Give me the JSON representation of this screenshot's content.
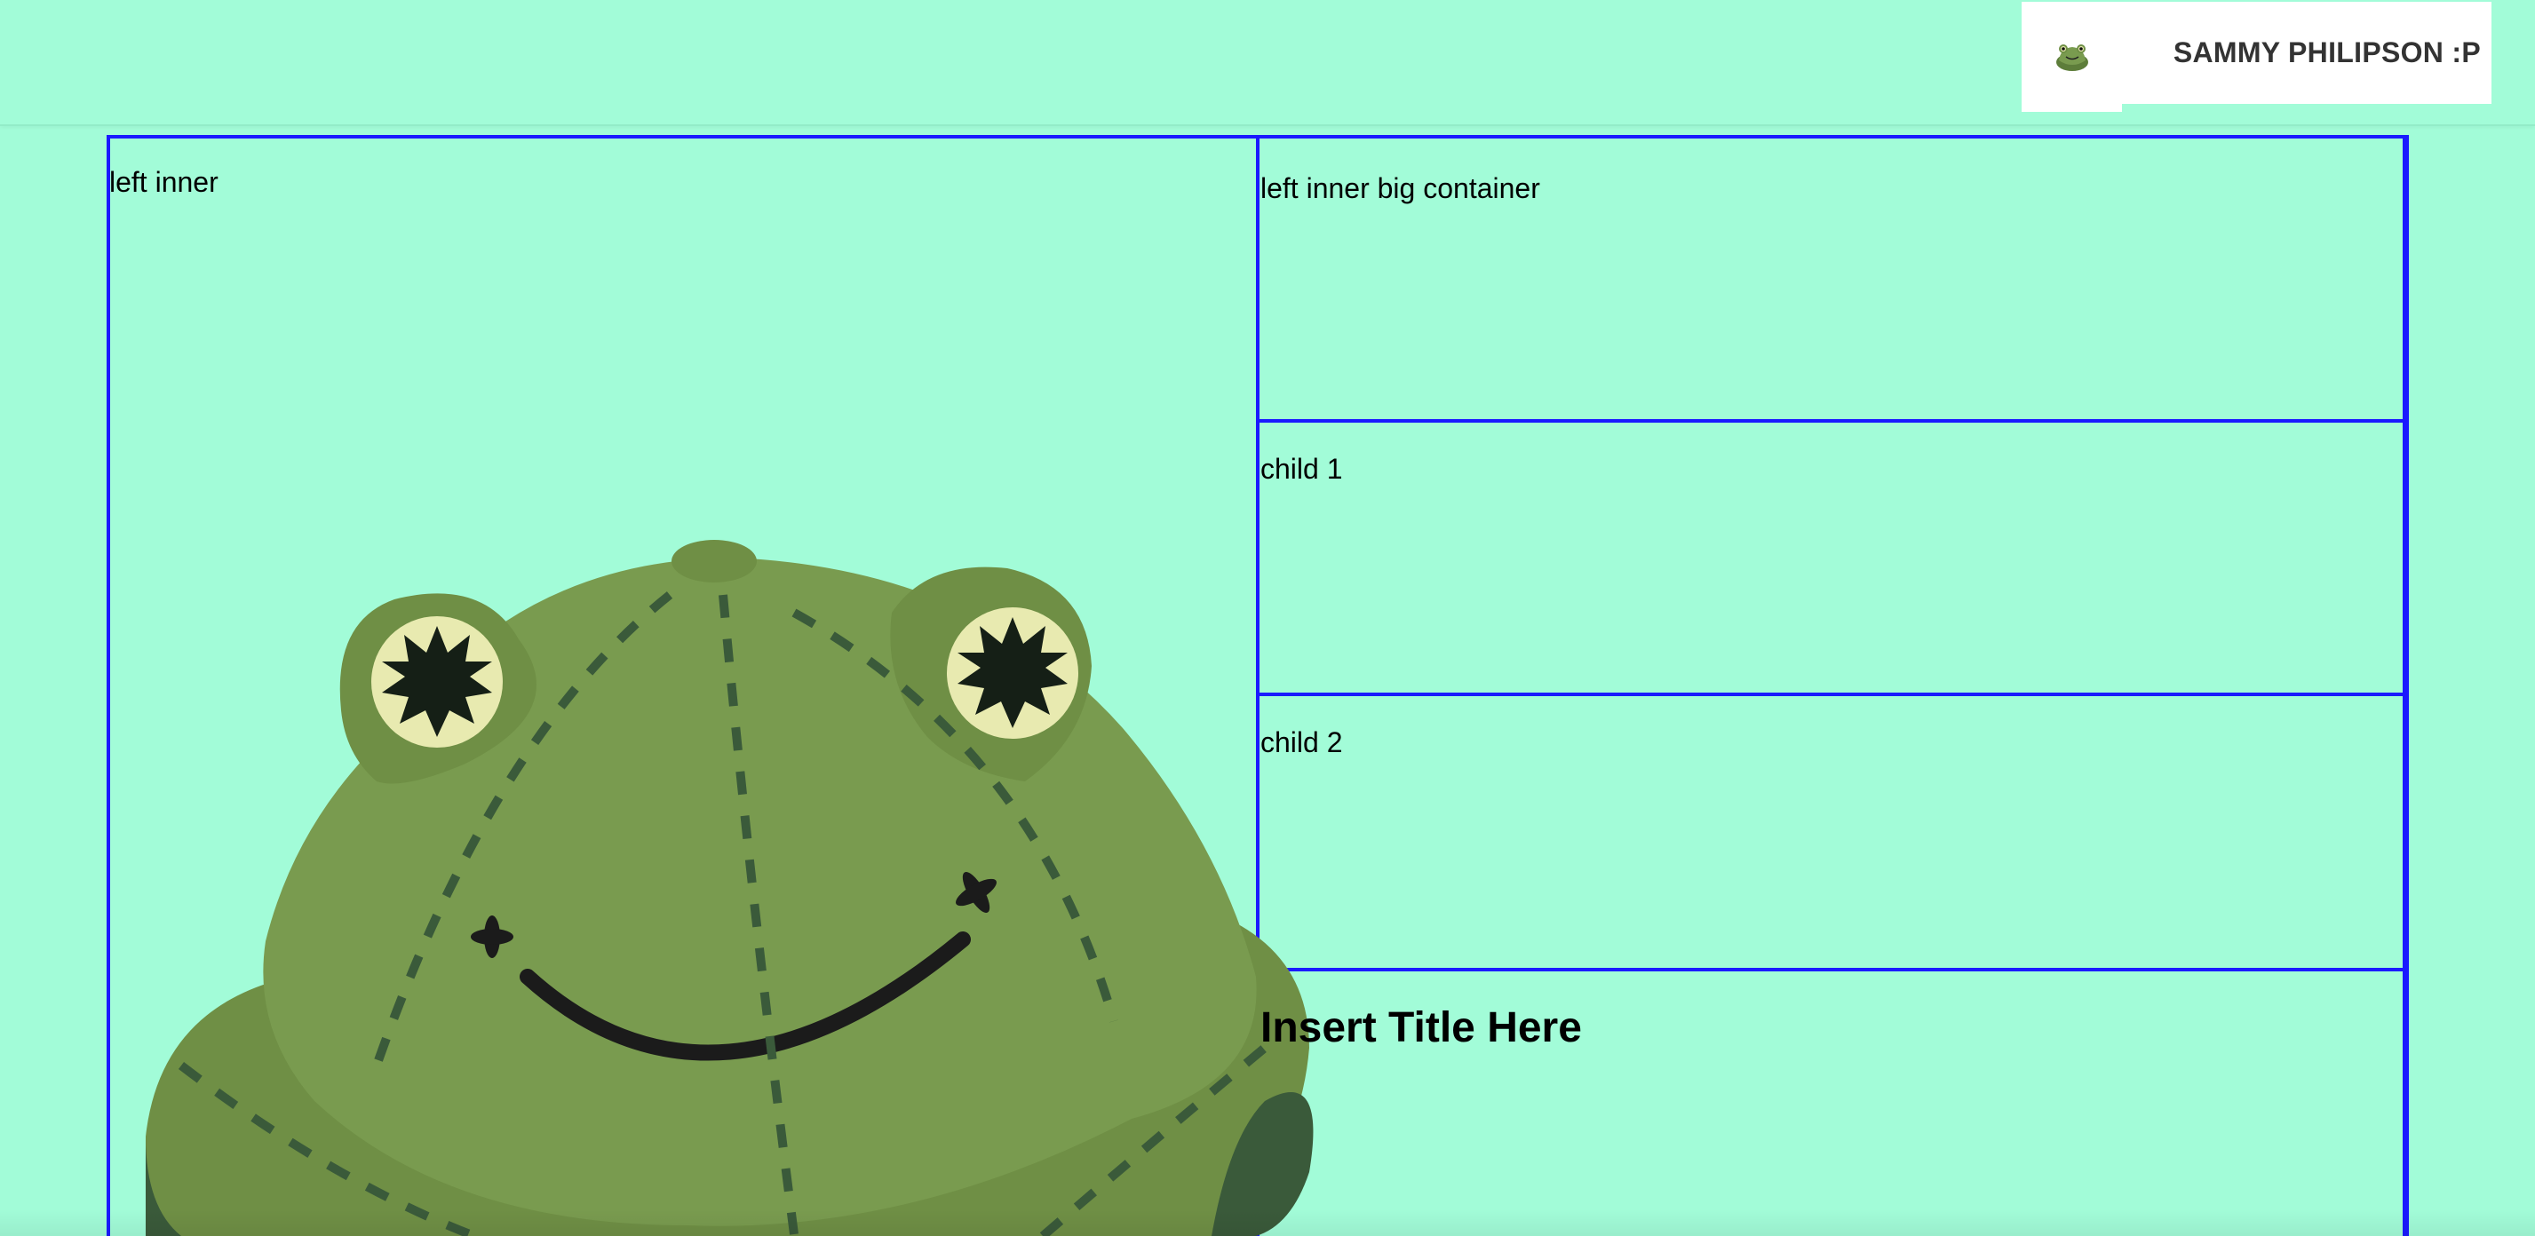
{
  "header": {
    "logo_icon": "frog-icon",
    "user_name": "SAMMY PHILIPSON :P"
  },
  "layout": {
    "left_inner_label": "left inner",
    "right": {
      "big_container_label": "left inner big container",
      "child1_label": "child 1",
      "child2_label": "child 2",
      "section_title": "Insert Title Here"
    }
  },
  "colors": {
    "background": "#a2fcd8",
    "border": "#1a1aff",
    "frog_green": "#799b4f",
    "frog_dark": "#3a5a3a"
  },
  "images": {
    "hero": "frog-hat-illustration"
  }
}
